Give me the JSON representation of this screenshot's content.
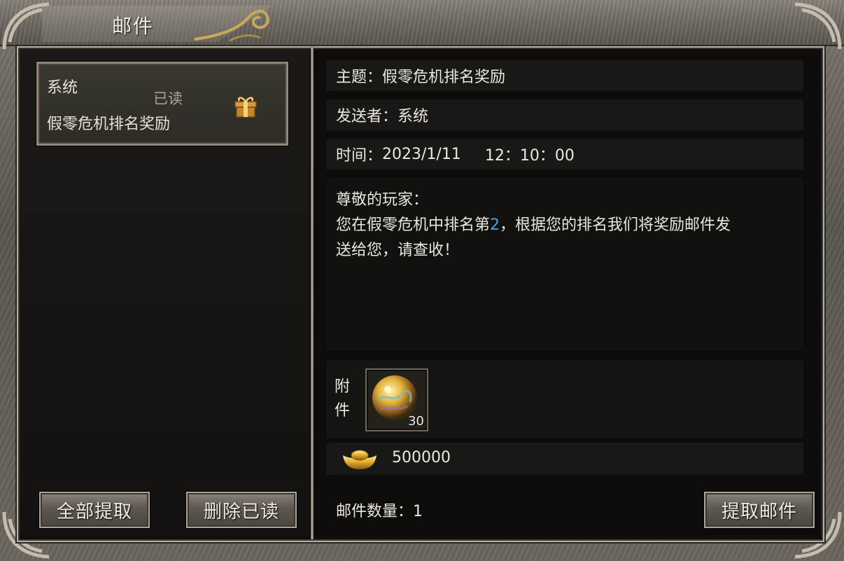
{
  "window": {
    "title": "邮件"
  },
  "mail_list": {
    "items": [
      {
        "sender": "系统",
        "status": "已读",
        "subject": "假零危机排名奖励",
        "icon": "gift-box-icon"
      }
    ],
    "buttons": {
      "extract_all": "全部提取",
      "delete_read": "删除已读"
    }
  },
  "detail": {
    "subject_label": "主题：",
    "subject": "假零危机排名奖励",
    "sender_label": "发送者：",
    "sender": "系统",
    "time_label": "时间：",
    "date": "2023/1/11",
    "clock": "12：10：00",
    "body": {
      "greeting": "尊敬的玩家：",
      "line1_prefix": "您在假零危机中排名第",
      "rank": "2",
      "line1_suffix": "，根据您的排名我们将奖励邮件发",
      "line2": "送给您，请查收！"
    },
    "attachment": {
      "label_1": "附",
      "label_2": "件",
      "items": [
        {
          "icon": "golden-dragon-orb-icon",
          "count": "30"
        }
      ]
    },
    "gold": {
      "icon": "gold-ingot-icon",
      "amount": "500000"
    },
    "mail_count_label": "邮件数量：",
    "mail_count": "1",
    "extract_button": "提取邮件"
  },
  "colors": {
    "highlight": "#3fa6e8",
    "frame": "#6e6a63",
    "panel": "#0f0e0d"
  }
}
